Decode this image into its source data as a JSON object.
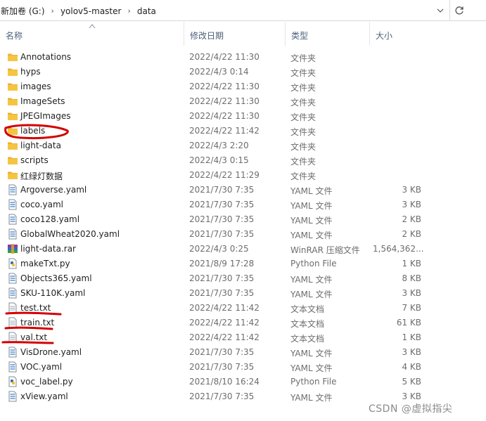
{
  "breadcrumb": {
    "items": [
      "新加卷 (G:)",
      "yolov5-master",
      "data"
    ],
    "separator": "›"
  },
  "columns": {
    "name": "名称",
    "modified": "修改日期",
    "type": "类型",
    "size": "大小"
  },
  "files": [
    {
      "name": "Annotations",
      "modified": "2022/4/22 11:30",
      "type": "文件夹",
      "size": "",
      "icon": "folder-icon"
    },
    {
      "name": "hyps",
      "modified": "2022/4/3 0:14",
      "type": "文件夹",
      "size": "",
      "icon": "folder-icon"
    },
    {
      "name": "images",
      "modified": "2022/4/22 11:30",
      "type": "文件夹",
      "size": "",
      "icon": "folder-icon"
    },
    {
      "name": "ImageSets",
      "modified": "2022/4/22 11:30",
      "type": "文件夹",
      "size": "",
      "icon": "folder-icon"
    },
    {
      "name": "JPEGImages",
      "modified": "2022/4/22 11:30",
      "type": "文件夹",
      "size": "",
      "icon": "folder-icon"
    },
    {
      "name": "labels",
      "modified": "2022/4/22 11:42",
      "type": "文件夹",
      "size": "",
      "icon": "folder-icon"
    },
    {
      "name": "light-data",
      "modified": "2022/4/3 2:20",
      "type": "文件夹",
      "size": "",
      "icon": "folder-icon"
    },
    {
      "name": "scripts",
      "modified": "2022/4/3 0:15",
      "type": "文件夹",
      "size": "",
      "icon": "folder-icon"
    },
    {
      "name": "红绿灯数据",
      "modified": "2022/4/22 11:29",
      "type": "文件夹",
      "size": "",
      "icon": "folder-icon"
    },
    {
      "name": "Argoverse.yaml",
      "modified": "2021/7/30 7:35",
      "type": "YAML 文件",
      "size": "3 KB",
      "icon": "yaml-file-icon"
    },
    {
      "name": "coco.yaml",
      "modified": "2021/7/30 7:35",
      "type": "YAML 文件",
      "size": "3 KB",
      "icon": "yaml-file-icon"
    },
    {
      "name": "coco128.yaml",
      "modified": "2021/7/30 7:35",
      "type": "YAML 文件",
      "size": "2 KB",
      "icon": "yaml-file-icon"
    },
    {
      "name": "GlobalWheat2020.yaml",
      "modified": "2021/7/30 7:35",
      "type": "YAML 文件",
      "size": "2 KB",
      "icon": "yaml-file-icon"
    },
    {
      "name": "light-data.rar",
      "modified": "2022/4/3 0:25",
      "type": "WinRAR 压缩文件",
      "size": "1,564,362...",
      "icon": "rar-archive-icon"
    },
    {
      "name": "makeTxt.py",
      "modified": "2021/8/9 17:28",
      "type": "Python File",
      "size": "1 KB",
      "icon": "python-file-icon"
    },
    {
      "name": "Objects365.yaml",
      "modified": "2021/7/30 7:35",
      "type": "YAML 文件",
      "size": "8 KB",
      "icon": "yaml-file-icon"
    },
    {
      "name": "SKU-110K.yaml",
      "modified": "2021/7/30 7:35",
      "type": "YAML 文件",
      "size": "3 KB",
      "icon": "yaml-file-icon"
    },
    {
      "name": "test.txt",
      "modified": "2022/4/22 11:42",
      "type": "文本文档",
      "size": "7 KB",
      "icon": "text-file-icon"
    },
    {
      "name": "train.txt",
      "modified": "2022/4/22 11:42",
      "type": "文本文档",
      "size": "61 KB",
      "icon": "text-file-icon"
    },
    {
      "name": "val.txt",
      "modified": "2022/4/22 11:42",
      "type": "文本文档",
      "size": "1 KB",
      "icon": "text-file-icon"
    },
    {
      "name": "VisDrone.yaml",
      "modified": "2021/7/30 7:35",
      "type": "YAML 文件",
      "size": "3 KB",
      "icon": "yaml-file-icon"
    },
    {
      "name": "VOC.yaml",
      "modified": "2021/7/30 7:35",
      "type": "YAML 文件",
      "size": "4 KB",
      "icon": "yaml-file-icon"
    },
    {
      "name": "voc_label.py",
      "modified": "2021/8/10 16:24",
      "type": "Python File",
      "size": "5 KB",
      "icon": "python-file-icon"
    },
    {
      "name": "xView.yaml",
      "modified": "2021/7/30 7:35",
      "type": "YAML 文件",
      "size": "3 KB",
      "icon": "yaml-file-icon"
    }
  ],
  "watermark": "CSDN @虚拟指尖",
  "colors": {
    "folder": "#f5c542",
    "annotation": "#d40000",
    "header_text": "#4c607a",
    "detail_text": "#6d6d6d"
  }
}
